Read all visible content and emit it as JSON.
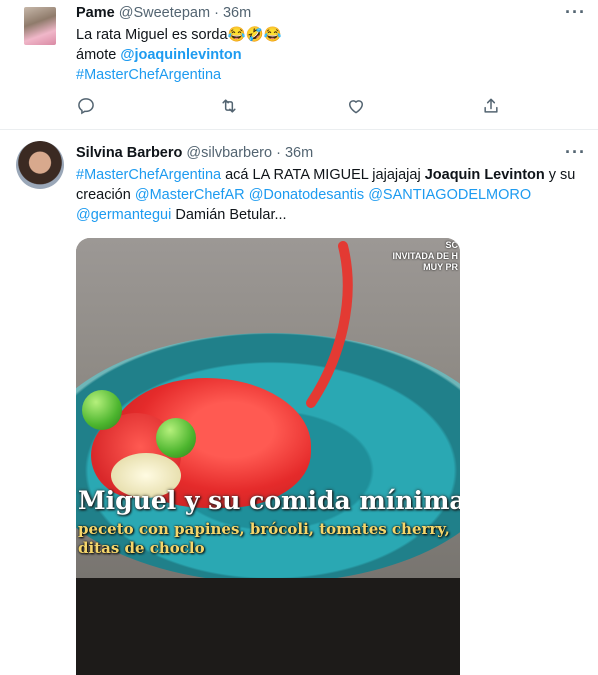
{
  "tweets": [
    {
      "name": "Pame",
      "handle": "@Sweetepam",
      "sep": "·",
      "time": "36m",
      "text_line1": "La rata Miguel es sorda😂🤣😂",
      "text_line2_prefix": "ámote ",
      "mention": "@joaquinlevinton",
      "hashtag": "#MasterChefArgentina",
      "actions": [
        "reply-icon",
        "retweet-icon",
        "like-icon",
        "share-icon"
      ]
    },
    {
      "name": "Silvina Barbero",
      "handle": "@silvbarbero",
      "sep": "·",
      "time": "36m",
      "l1_hashtag": "#MasterChefArgentina",
      "l1_text": " acá LA RATA MIGUEL jajajajaj ",
      "l1_bold": "Joaquin Levinton",
      "l1_end": " y su",
      "l2_start": "creación ",
      "l2_m1": "@MasterChefAR",
      "l2_m2": "@Donatodesantis",
      "l2_m3": "@SANTIAGODELMORO",
      "l3_m1": "@germantegui",
      "l3_text": " Damián Betular...",
      "media": {
        "caption_title": "Miguel y su comida mínima",
        "caption_line1": "peceto con papines, brócoli, tomates cherry,",
        "caption_line2": "ditas de choclo",
        "watermark": "SC\nINVITADA DE H\nMUY PR"
      }
    }
  ],
  "colors": {
    "link": "#1d9bf0",
    "muted": "#536471",
    "divider": "#ebeef0"
  }
}
